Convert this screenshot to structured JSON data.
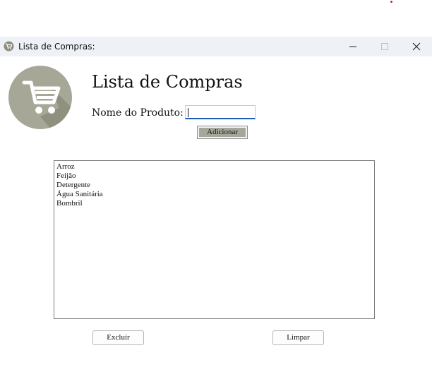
{
  "window": {
    "title": "Lista de Compras:"
  },
  "titlebar": {
    "icons": [
      "app-cart-icon",
      "minimize-icon",
      "maximize-icon",
      "close-icon"
    ]
  },
  "logo": {
    "icon": "shopping-cart-icon",
    "color": "#a6a796"
  },
  "main": {
    "heading": "Lista de Compras",
    "product_label": "Nome do Produto:",
    "product_value": "",
    "add_label": "Adicionar"
  },
  "list": {
    "items": [
      "Arroz",
      "Feijão",
      "Detergente",
      "Água Sanitária",
      "Bombril"
    ]
  },
  "footer": {
    "delete_label": "Excluir",
    "clear_label": "Limpar"
  },
  "colors": {
    "accent": "#1a5fb4",
    "titlebar": "#eef1f6",
    "add_button_fill": "#a6a79a"
  }
}
